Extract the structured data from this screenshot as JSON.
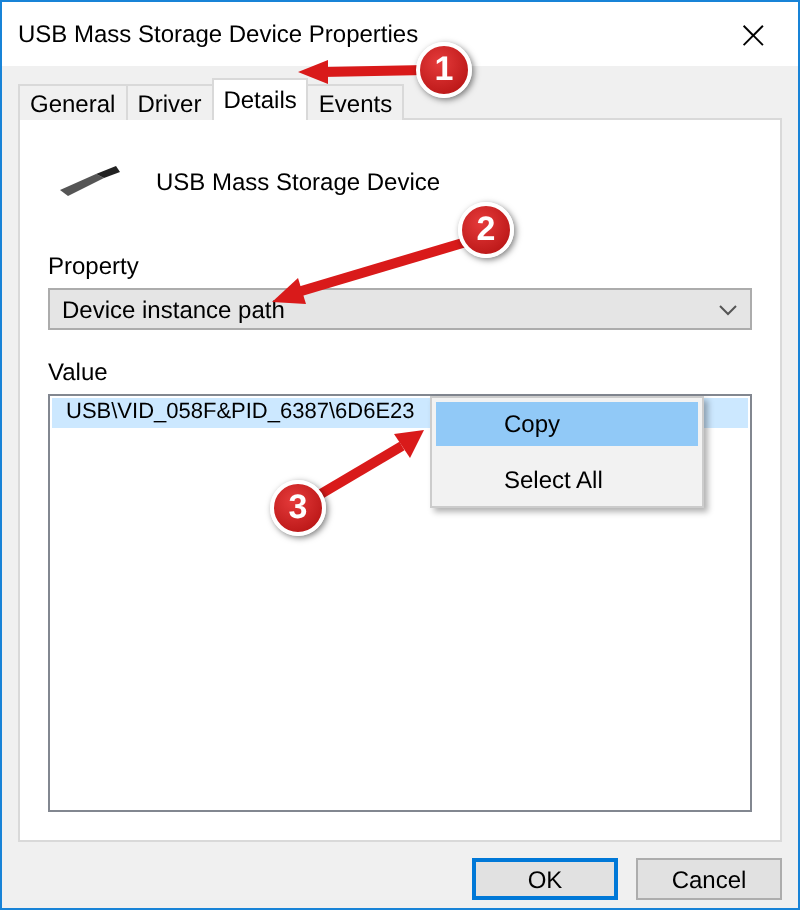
{
  "window": {
    "title": "USB Mass Storage Device Properties",
    "close": "×"
  },
  "tabs": [
    {
      "label": "General",
      "selected": false
    },
    {
      "label": "Driver",
      "selected": false
    },
    {
      "label": "Details",
      "selected": true
    },
    {
      "label": "Events",
      "selected": false
    }
  ],
  "device_name": "USB Mass Storage Device",
  "property": {
    "label": "Property",
    "value": "Device instance path"
  },
  "value": {
    "label": "Value",
    "rows": [
      {
        "text": "USB\\VID_058F&PID_6387\\6D6E23",
        "selected": true
      }
    ]
  },
  "context_menu": [
    {
      "label": "Copy",
      "selected": true
    },
    {
      "label": "Select All",
      "selected": false
    }
  ],
  "callouts": [
    {
      "number": "1"
    },
    {
      "number": "2"
    },
    {
      "number": "3"
    }
  ],
  "buttons": [
    {
      "label": "OK",
      "default": true
    },
    {
      "label": "Cancel",
      "default": false
    }
  ]
}
